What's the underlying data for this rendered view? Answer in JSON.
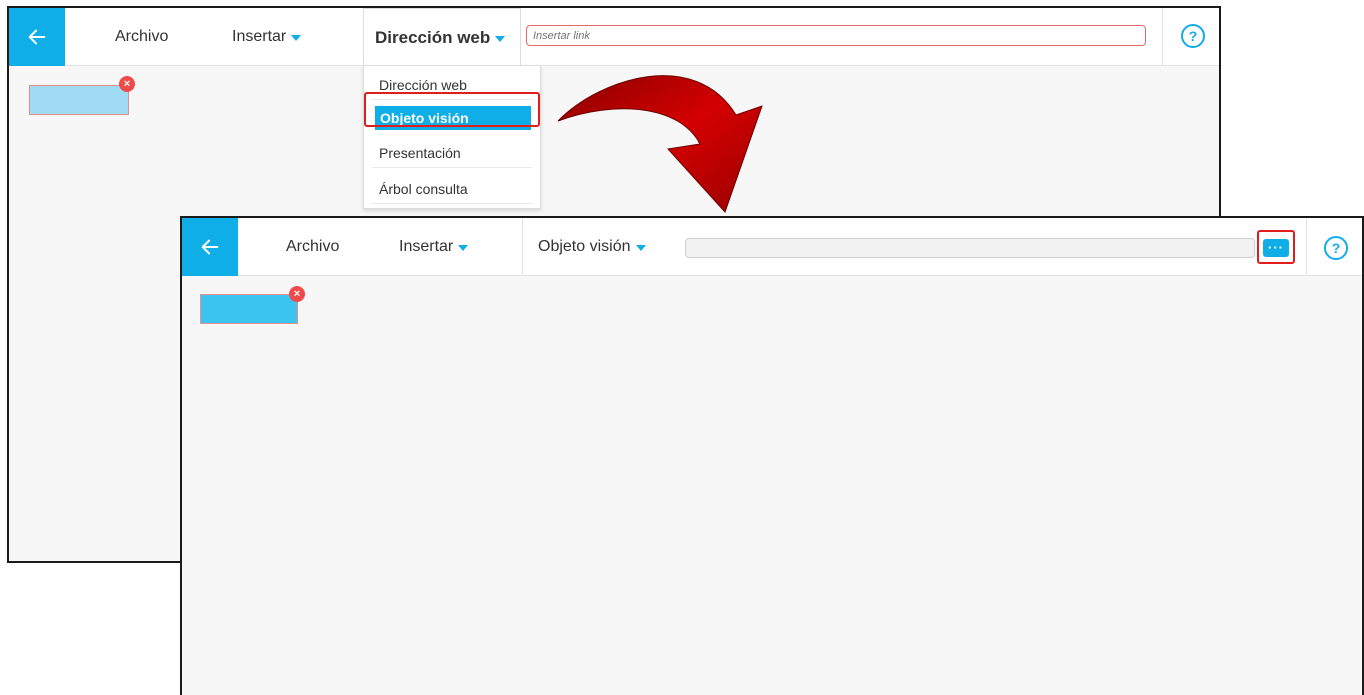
{
  "window_back": {
    "toolbar": {
      "archivo": "Archivo",
      "insertar": "Insertar",
      "type_selector": "Dirección web",
      "url_placeholder": "Insertar link",
      "help": "?"
    },
    "dropdown": {
      "items": [
        "Dirección web",
        "Objeto visión",
        "Presentación",
        "Árbol consulta"
      ],
      "selected": "Objeto visión"
    },
    "widget_close": "×"
  },
  "window_front": {
    "toolbar": {
      "archivo": "Archivo",
      "insertar": "Insertar",
      "type_selector": "Objeto visión",
      "more": "···",
      "help": "?"
    },
    "widget_close": "×"
  },
  "colors": {
    "accent": "#10aee6",
    "highlight": "#e01e1e",
    "arrow": "#c40000",
    "close_badge": "#ef4b4b"
  },
  "icons": {
    "back": "arrow-left-icon",
    "help": "question-circle-icon",
    "caret": "caret-down-icon",
    "more": "ellipsis-icon",
    "close": "close-icon",
    "transition": "curved-arrow-icon"
  }
}
